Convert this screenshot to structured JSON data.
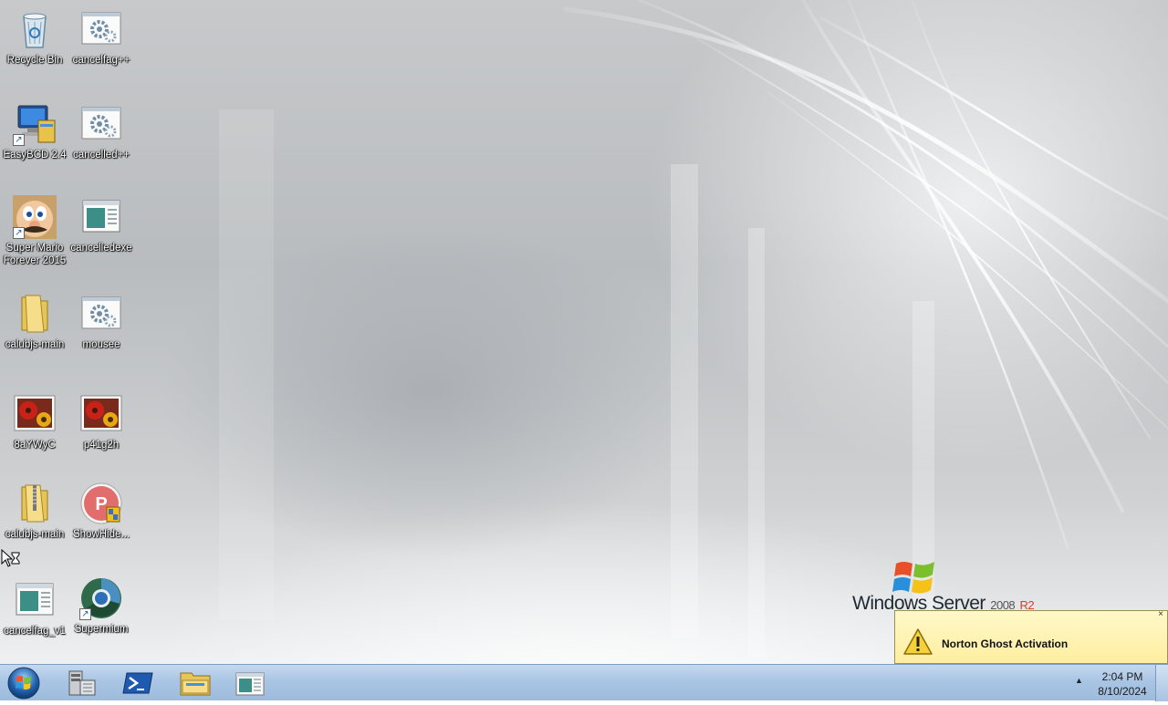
{
  "desktop": {
    "icons": [
      {
        "name": "recycle-bin-icon",
        "label": "Recycle Bin"
      },
      {
        "name": "settings-exe-icon",
        "label": "cancelfag++"
      },
      {
        "name": "easybcd-icon",
        "label": "EasyBCD 2.4"
      },
      {
        "name": "settings-exe-icon",
        "label": "cancelled++"
      },
      {
        "name": "mario-icon",
        "label": "Super Mario Forever 2015"
      },
      {
        "name": "window-app-icon",
        "label": "cancelledexe"
      },
      {
        "name": "folder-icon",
        "label": "calubjs-main"
      },
      {
        "name": "settings-exe-icon",
        "label": "mousee"
      },
      {
        "name": "flower-image-icon",
        "label": "8aYWyC"
      },
      {
        "name": "flower-image-icon",
        "label": "p41g2h"
      },
      {
        "name": "zip-folder-icon",
        "label": "calubjs-main"
      },
      {
        "name": "showhide-icon",
        "label": "ShowHide..."
      },
      {
        "name": "window-app-icon",
        "label": "cancelfag_v1"
      },
      {
        "name": "supermium-icon",
        "label": "Supermium"
      }
    ]
  },
  "wallpaper": {
    "logo_word": "Windows Server",
    "logo_version": "2008",
    "logo_release": "R2"
  },
  "notification": {
    "title": "Norton Ghost Activation",
    "close_glyph": "×"
  },
  "taskbar": {
    "pinned": [
      {
        "name": "server-manager-icon"
      },
      {
        "name": "powershell-icon"
      },
      {
        "name": "explorer-icon"
      },
      {
        "name": "window-app-icon"
      }
    ],
    "tray_arrow": "▲",
    "clock_time": "2:04 PM",
    "clock_date": "8/10/2024"
  },
  "colors": {
    "taskbar": "#a9c5e4",
    "balloon": "#ffeea0",
    "logo_release": "#d4421e"
  }
}
